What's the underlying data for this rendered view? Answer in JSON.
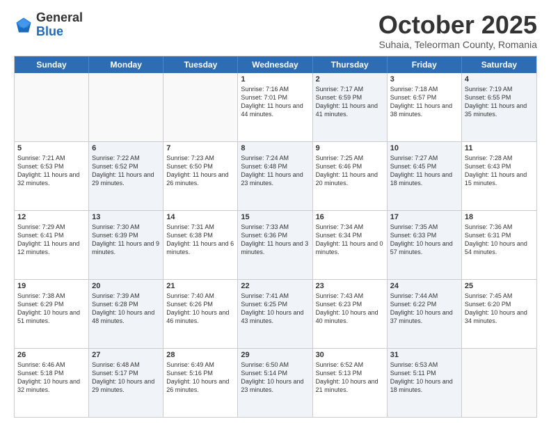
{
  "logo": {
    "general": "General",
    "blue": "Blue"
  },
  "header": {
    "title": "October 2025",
    "subtitle": "Suhaia, Teleorman County, Romania"
  },
  "weekdays": [
    "Sunday",
    "Monday",
    "Tuesday",
    "Wednesday",
    "Thursday",
    "Friday",
    "Saturday"
  ],
  "weeks": [
    [
      {
        "day": "",
        "sunrise": "",
        "sunset": "",
        "daylight": "",
        "shaded": false,
        "empty": true
      },
      {
        "day": "",
        "sunrise": "",
        "sunset": "",
        "daylight": "",
        "shaded": false,
        "empty": true
      },
      {
        "day": "",
        "sunrise": "",
        "sunset": "",
        "daylight": "",
        "shaded": false,
        "empty": true
      },
      {
        "day": "1",
        "sunrise": "Sunrise: 7:16 AM",
        "sunset": "Sunset: 7:01 PM",
        "daylight": "Daylight: 11 hours and 44 minutes.",
        "shaded": false,
        "empty": false
      },
      {
        "day": "2",
        "sunrise": "Sunrise: 7:17 AM",
        "sunset": "Sunset: 6:59 PM",
        "daylight": "Daylight: 11 hours and 41 minutes.",
        "shaded": true,
        "empty": false
      },
      {
        "day": "3",
        "sunrise": "Sunrise: 7:18 AM",
        "sunset": "Sunset: 6:57 PM",
        "daylight": "Daylight: 11 hours and 38 minutes.",
        "shaded": false,
        "empty": false
      },
      {
        "day": "4",
        "sunrise": "Sunrise: 7:19 AM",
        "sunset": "Sunset: 6:55 PM",
        "daylight": "Daylight: 11 hours and 35 minutes.",
        "shaded": true,
        "empty": false
      }
    ],
    [
      {
        "day": "5",
        "sunrise": "Sunrise: 7:21 AM",
        "sunset": "Sunset: 6:53 PM",
        "daylight": "Daylight: 11 hours and 32 minutes.",
        "shaded": false,
        "empty": false
      },
      {
        "day": "6",
        "sunrise": "Sunrise: 7:22 AM",
        "sunset": "Sunset: 6:52 PM",
        "daylight": "Daylight: 11 hours and 29 minutes.",
        "shaded": true,
        "empty": false
      },
      {
        "day": "7",
        "sunrise": "Sunrise: 7:23 AM",
        "sunset": "Sunset: 6:50 PM",
        "daylight": "Daylight: 11 hours and 26 minutes.",
        "shaded": false,
        "empty": false
      },
      {
        "day": "8",
        "sunrise": "Sunrise: 7:24 AM",
        "sunset": "Sunset: 6:48 PM",
        "daylight": "Daylight: 11 hours and 23 minutes.",
        "shaded": true,
        "empty": false
      },
      {
        "day": "9",
        "sunrise": "Sunrise: 7:25 AM",
        "sunset": "Sunset: 6:46 PM",
        "daylight": "Daylight: 11 hours and 20 minutes.",
        "shaded": false,
        "empty": false
      },
      {
        "day": "10",
        "sunrise": "Sunrise: 7:27 AM",
        "sunset": "Sunset: 6:45 PM",
        "daylight": "Daylight: 11 hours and 18 minutes.",
        "shaded": true,
        "empty": false
      },
      {
        "day": "11",
        "sunrise": "Sunrise: 7:28 AM",
        "sunset": "Sunset: 6:43 PM",
        "daylight": "Daylight: 11 hours and 15 minutes.",
        "shaded": false,
        "empty": false
      }
    ],
    [
      {
        "day": "12",
        "sunrise": "Sunrise: 7:29 AM",
        "sunset": "Sunset: 6:41 PM",
        "daylight": "Daylight: 11 hours and 12 minutes.",
        "shaded": false,
        "empty": false
      },
      {
        "day": "13",
        "sunrise": "Sunrise: 7:30 AM",
        "sunset": "Sunset: 6:39 PM",
        "daylight": "Daylight: 11 hours and 9 minutes.",
        "shaded": true,
        "empty": false
      },
      {
        "day": "14",
        "sunrise": "Sunrise: 7:31 AM",
        "sunset": "Sunset: 6:38 PM",
        "daylight": "Daylight: 11 hours and 6 minutes.",
        "shaded": false,
        "empty": false
      },
      {
        "day": "15",
        "sunrise": "Sunrise: 7:33 AM",
        "sunset": "Sunset: 6:36 PM",
        "daylight": "Daylight: 11 hours and 3 minutes.",
        "shaded": true,
        "empty": false
      },
      {
        "day": "16",
        "sunrise": "Sunrise: 7:34 AM",
        "sunset": "Sunset: 6:34 PM",
        "daylight": "Daylight: 11 hours and 0 minutes.",
        "shaded": false,
        "empty": false
      },
      {
        "day": "17",
        "sunrise": "Sunrise: 7:35 AM",
        "sunset": "Sunset: 6:33 PM",
        "daylight": "Daylight: 10 hours and 57 minutes.",
        "shaded": true,
        "empty": false
      },
      {
        "day": "18",
        "sunrise": "Sunrise: 7:36 AM",
        "sunset": "Sunset: 6:31 PM",
        "daylight": "Daylight: 10 hours and 54 minutes.",
        "shaded": false,
        "empty": false
      }
    ],
    [
      {
        "day": "19",
        "sunrise": "Sunrise: 7:38 AM",
        "sunset": "Sunset: 6:29 PM",
        "daylight": "Daylight: 10 hours and 51 minutes.",
        "shaded": false,
        "empty": false
      },
      {
        "day": "20",
        "sunrise": "Sunrise: 7:39 AM",
        "sunset": "Sunset: 6:28 PM",
        "daylight": "Daylight: 10 hours and 48 minutes.",
        "shaded": true,
        "empty": false
      },
      {
        "day": "21",
        "sunrise": "Sunrise: 7:40 AM",
        "sunset": "Sunset: 6:26 PM",
        "daylight": "Daylight: 10 hours and 46 minutes.",
        "shaded": false,
        "empty": false
      },
      {
        "day": "22",
        "sunrise": "Sunrise: 7:41 AM",
        "sunset": "Sunset: 6:25 PM",
        "daylight": "Daylight: 10 hours and 43 minutes.",
        "shaded": true,
        "empty": false
      },
      {
        "day": "23",
        "sunrise": "Sunrise: 7:43 AM",
        "sunset": "Sunset: 6:23 PM",
        "daylight": "Daylight: 10 hours and 40 minutes.",
        "shaded": false,
        "empty": false
      },
      {
        "day": "24",
        "sunrise": "Sunrise: 7:44 AM",
        "sunset": "Sunset: 6:22 PM",
        "daylight": "Daylight: 10 hours and 37 minutes.",
        "shaded": true,
        "empty": false
      },
      {
        "day": "25",
        "sunrise": "Sunrise: 7:45 AM",
        "sunset": "Sunset: 6:20 PM",
        "daylight": "Daylight: 10 hours and 34 minutes.",
        "shaded": false,
        "empty": false
      }
    ],
    [
      {
        "day": "26",
        "sunrise": "Sunrise: 6:46 AM",
        "sunset": "Sunset: 5:18 PM",
        "daylight": "Daylight: 10 hours and 32 minutes.",
        "shaded": false,
        "empty": false
      },
      {
        "day": "27",
        "sunrise": "Sunrise: 6:48 AM",
        "sunset": "Sunset: 5:17 PM",
        "daylight": "Daylight: 10 hours and 29 minutes.",
        "shaded": true,
        "empty": false
      },
      {
        "day": "28",
        "sunrise": "Sunrise: 6:49 AM",
        "sunset": "Sunset: 5:16 PM",
        "daylight": "Daylight: 10 hours and 26 minutes.",
        "shaded": false,
        "empty": false
      },
      {
        "day": "29",
        "sunrise": "Sunrise: 6:50 AM",
        "sunset": "Sunset: 5:14 PM",
        "daylight": "Daylight: 10 hours and 23 minutes.",
        "shaded": true,
        "empty": false
      },
      {
        "day": "30",
        "sunrise": "Sunrise: 6:52 AM",
        "sunset": "Sunset: 5:13 PM",
        "daylight": "Daylight: 10 hours and 21 minutes.",
        "shaded": false,
        "empty": false
      },
      {
        "day": "31",
        "sunrise": "Sunrise: 6:53 AM",
        "sunset": "Sunset: 5:11 PM",
        "daylight": "Daylight: 10 hours and 18 minutes.",
        "shaded": true,
        "empty": false
      },
      {
        "day": "",
        "sunrise": "",
        "sunset": "",
        "daylight": "",
        "shaded": false,
        "empty": true
      }
    ]
  ]
}
